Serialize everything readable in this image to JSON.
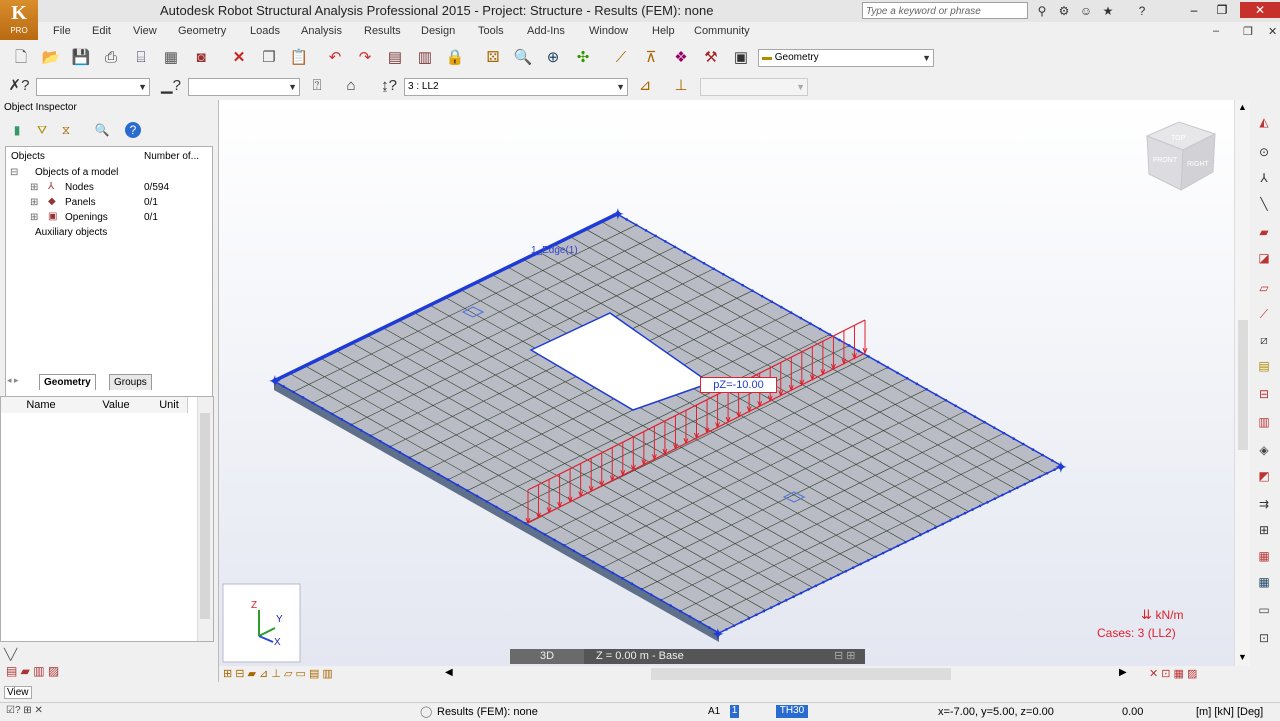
{
  "title": "Autodesk Robot Structural Analysis Professional 2015 - Project: Structure - Results (FEM): none",
  "logo": {
    "letter": "K",
    "label": "PRO"
  },
  "search_placeholder": "Type a keyword or phrase",
  "menu": [
    "File",
    "Edit",
    "View",
    "Geometry",
    "Loads",
    "Analysis",
    "Results",
    "Design",
    "Tools",
    "Add-Ins",
    "Window",
    "Help",
    "Community"
  ],
  "toolbar1": {
    "layout_combo": "Geometry"
  },
  "toolbar2": {
    "load_case_combo": "3 : LL2"
  },
  "inspector": {
    "title": "Object Inspector",
    "col_objects": "Objects",
    "col_number": "Number of...",
    "root": "Objects of a model",
    "items": [
      {
        "label": "Nodes",
        "count": "0/594"
      },
      {
        "label": "Panels",
        "count": "0/1"
      },
      {
        "label": "Openings",
        "count": "0/1"
      }
    ],
    "aux": "Auxiliary objects",
    "tabs": [
      "Geometry",
      "Groups"
    ],
    "props_headers": [
      "Name",
      "Value",
      "Unit"
    ]
  },
  "viewport": {
    "load_label": "pZ=-10.00",
    "edge_label": "1_Edge(1)",
    "units_label": "kN/m",
    "cases_label": "Cases: 3 (LL2)",
    "view_tab_3d": "3D",
    "view_tab_plane": "Z = 0.00 m - Base",
    "cube_top": "TOP",
    "cube_front": "FRONT",
    "cube_right": "RIGHT",
    "axis_x": "X",
    "axis_y": "Y",
    "axis_z": "Z"
  },
  "view_label": "View",
  "status": {
    "results": "Results (FEM): none",
    "a1": "A1",
    "one": "1",
    "th": "TH30",
    "coords": "x=-7.00, y=5.00, z=0.00",
    "zero": "0.00",
    "units": "[m] [kN] [Deg]"
  },
  "colors": {
    "mesh": "#2a3a2a",
    "panel": "#b9bcc4",
    "edge": "#1f3bd6",
    "load": "#e0202e",
    "cases": "#e0202e"
  }
}
